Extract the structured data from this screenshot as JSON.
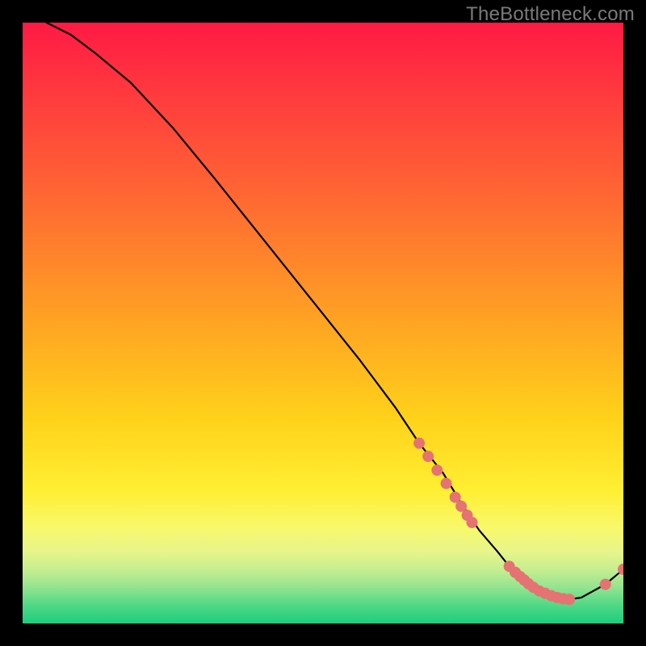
{
  "watermark": "TheBottleneck.com",
  "colors": {
    "dot": "#e57373",
    "curve": "#000000"
  },
  "chart_data": {
    "type": "line",
    "title": "",
    "xlabel": "",
    "ylabel": "",
    "xlim": [
      0,
      100
    ],
    "ylim": [
      0,
      100
    ],
    "grid": false,
    "legend": false,
    "series": [
      {
        "name": "curve",
        "x": [
          4,
          8,
          12,
          18,
          25,
          32,
          40,
          48,
          56,
          62,
          66,
          70,
          73,
          76,
          79,
          81,
          83,
          85,
          87,
          89,
          91,
          93,
          97,
          100
        ],
        "y": [
          100,
          98,
          95,
          90,
          82.5,
          74,
          64,
          54,
          44,
          36,
          30,
          25,
          20,
          15.5,
          12,
          9.5,
          7.5,
          6,
          5,
          4.3,
          4,
          4.3,
          6.5,
          9
        ]
      }
    ],
    "markers": [
      {
        "x": 66,
        "y": 30
      },
      {
        "x": 67.5,
        "y": 27.8
      },
      {
        "x": 69,
        "y": 25.5
      },
      {
        "x": 70.5,
        "y": 23.3
      },
      {
        "x": 72,
        "y": 21
      },
      {
        "x": 73,
        "y": 19.5
      },
      {
        "x": 74,
        "y": 18
      },
      {
        "x": 74.8,
        "y": 16.8
      },
      {
        "x": 81,
        "y": 9.5
      },
      {
        "x": 82,
        "y": 8.5
      },
      {
        "x": 82.8,
        "y": 7.8
      },
      {
        "x": 83.5,
        "y": 7.2
      },
      {
        "x": 84.2,
        "y": 6.6
      },
      {
        "x": 85,
        "y": 6.0
      },
      {
        "x": 86,
        "y": 5.4
      },
      {
        "x": 87,
        "y": 5.0
      },
      {
        "x": 88,
        "y": 4.6
      },
      {
        "x": 89,
        "y": 4.3
      },
      {
        "x": 90,
        "y": 4.1
      },
      {
        "x": 91,
        "y": 4.0
      },
      {
        "x": 97,
        "y": 6.5
      },
      {
        "x": 100,
        "y": 9.0
      }
    ]
  }
}
